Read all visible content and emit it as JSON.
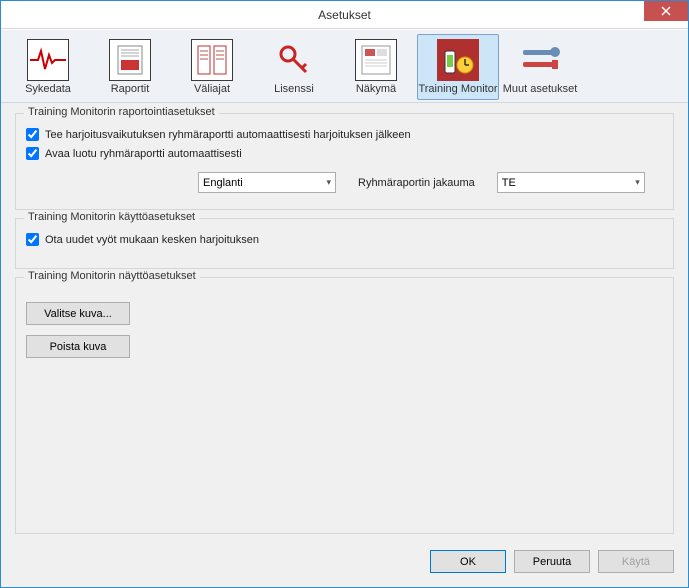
{
  "window": {
    "title": "Asetukset"
  },
  "toolbar": {
    "items": [
      {
        "label": "Sykedata"
      },
      {
        "label": "Raportit"
      },
      {
        "label": "Väliajat"
      },
      {
        "label": "Lisenssi"
      },
      {
        "label": "Näkymä"
      },
      {
        "label": "Training Monitor"
      },
      {
        "label": "Muut asetukset"
      }
    ]
  },
  "group_report": {
    "title": "Training Monitorin raportointiasetukset",
    "chk_auto_report": "Tee harjoitusvaikutuksen ryhmäraportti automaattisesti harjoituksen jälkeen",
    "chk_auto_open": "Avaa luotu ryhmäraportti automaattisesti",
    "lang_selected": "Englanti",
    "dist_label": "Ryhmäraportin jakauma",
    "dist_selected": "TE"
  },
  "group_usage": {
    "title": "Training Monitorin käyttöasetukset",
    "chk_new_belts": "Ota uudet vyöt mukaan kesken harjoituksen"
  },
  "group_display": {
    "title": "Training Monitorin näyttöasetukset",
    "btn_select_image": "Valitse kuva...",
    "btn_remove_image": "Poista kuva"
  },
  "footer": {
    "ok": "OK",
    "cancel": "Peruuta",
    "apply": "Käytä"
  }
}
